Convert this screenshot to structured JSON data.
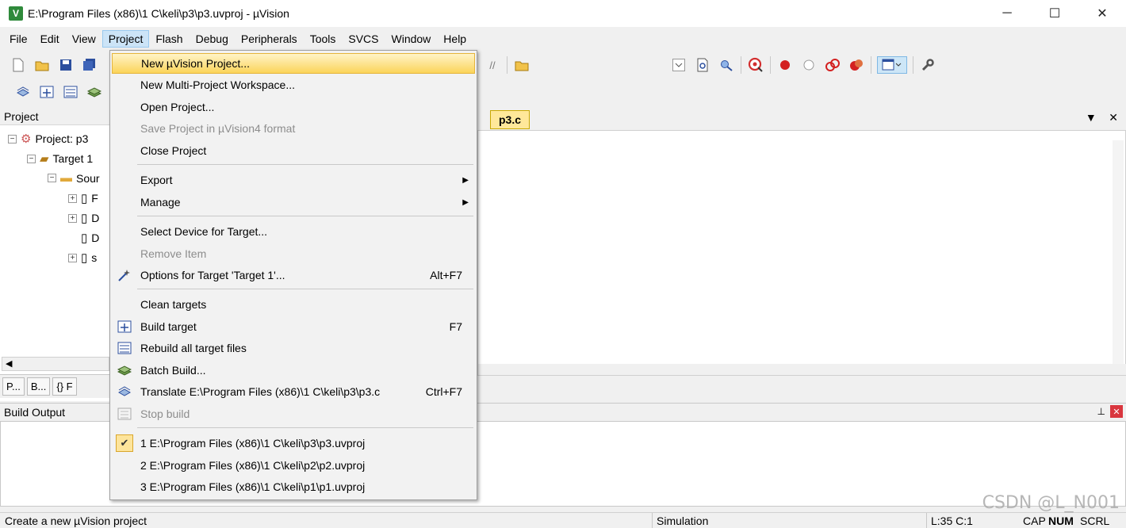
{
  "window": {
    "title": "E:\\Program Files (x86)\\1 C\\keli\\p3\\p3.uvproj - µVision",
    "icon_letter": "V",
    "minimize": "─",
    "maximize": "☐",
    "close": "✕"
  },
  "menubar": [
    "File",
    "Edit",
    "View",
    "Project",
    "Flash",
    "Debug",
    "Peripherals",
    "Tools",
    "SVCS",
    "Window",
    "Help"
  ],
  "project_panel": {
    "title": "Project",
    "root": "Project: p3",
    "target": "Target 1",
    "group": "Sour",
    "files": [
      "F",
      "D",
      "D",
      "s"
    ],
    "tabs": [
      "P...",
      "B...",
      "{} F"
    ]
  },
  "editor": {
    "active_tab": "p3.c",
    "tab_dropdown": "▼",
    "tab_close": "✕"
  },
  "build_output": {
    "title": "Build Output",
    "pin": "📌",
    "close": "✕"
  },
  "statusbar": {
    "message": "Create a new µVision project",
    "mode": "Simulation",
    "position": "L:35 C:1",
    "cap": "CAP",
    "num": "NUM",
    "scrl": "SCRL"
  },
  "watermark": "CSDN @L_N001",
  "project_menu": {
    "new_project": "New µVision Project...",
    "new_multi": "New Multi-Project Workspace...",
    "open_project": "Open Project...",
    "save_uv4": "Save Project in µVision4 format",
    "close_project": "Close Project",
    "export": "Export",
    "manage": "Manage",
    "select_device": "Select Device for Target...",
    "remove_item": "Remove Item",
    "options_target": "Options for Target 'Target 1'...",
    "options_shortcut": "Alt+F7",
    "clean_targets": "Clean targets",
    "build_target": "Build target",
    "build_shortcut": "F7",
    "rebuild_all": "Rebuild all target files",
    "batch_build": "Batch Build...",
    "translate": "Translate E:\\Program Files (x86)\\1 C\\keli\\p3\\p3.c",
    "translate_shortcut": "Ctrl+F7",
    "stop_build": "Stop build",
    "recent_1": "1 E:\\Program Files (x86)\\1 C\\keli\\p3\\p3.uvproj",
    "recent_2": "2 E:\\Program Files (x86)\\1 C\\keli\\p2\\p2.uvproj",
    "recent_3": "3 E:\\Program Files (x86)\\1 C\\keli\\p1\\p1.uvproj",
    "check": "✔"
  },
  "icons": {
    "toolbar1_left": [
      "new-file-icon",
      "open-folder-icon",
      "save-icon",
      "save-all-icon"
    ],
    "toolbar1_right": [
      "indent-icon",
      "open-file-icon",
      "dropdown-icon",
      "find-in-files-icon",
      "find-icon",
      "debug-session-icon",
      "breakpoint-icon",
      "disabled-breakpoint-icon",
      "disable-all-breakpoints-icon",
      "kill-breakpoints-icon",
      "window-layout-icon",
      "configure-icon"
    ],
    "toolbar2": [
      "translate-icon",
      "build-icon",
      "rebuild-icon",
      "batch-build-icon"
    ]
  }
}
